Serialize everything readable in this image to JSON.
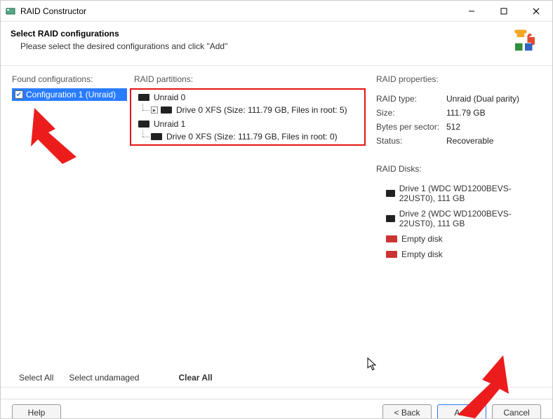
{
  "window": {
    "title": "RAID Constructor"
  },
  "header": {
    "title": "Select RAID configurations",
    "subtitle": "Please select the desired configurations and click \"Add\""
  },
  "labels": {
    "found": "Found configurations:",
    "partitions": "RAID partitions:",
    "properties": "RAID properties:",
    "disks": "RAID Disks:"
  },
  "found_configs": [
    {
      "label": "Configuration 1 (Unraid)",
      "checked": true,
      "selected": true
    }
  ],
  "partitions": [
    {
      "label": "Unraid 0",
      "children": [
        {
          "label": "Drive 0 XFS (Size: 111.79 GB, Files in root: 5)",
          "expandable": true
        }
      ]
    },
    {
      "label": "Unraid 1",
      "children": [
        {
          "label": "Drive 0 XFS (Size: 111.79 GB, Files in root: 0)",
          "expandable": false
        }
      ]
    }
  ],
  "properties": {
    "type_k": "RAID type:",
    "type_v": "Unraid (Dual parity)",
    "size_k": "Size:",
    "size_v": "111.79 GB",
    "bps_k": "Bytes per sector:",
    "bps_v": "512",
    "status_k": "Status:",
    "status_v": "Recoverable"
  },
  "disks": [
    {
      "label": "Drive 1 (WDC WD1200BEVS-22UST0), 111 GB",
      "empty": false
    },
    {
      "label": "Drive 2 (WDC WD1200BEVS-22UST0), 111 GB",
      "empty": false
    },
    {
      "label": "Empty disk",
      "empty": true
    },
    {
      "label": "Empty disk",
      "empty": true
    }
  ],
  "links": {
    "select_all": "Select All",
    "select_undamaged": "Select undamaged",
    "clear_all": "Clear All"
  },
  "buttons": {
    "help": "Help",
    "back": "< Back",
    "add": "Add",
    "cancel": "Cancel"
  }
}
